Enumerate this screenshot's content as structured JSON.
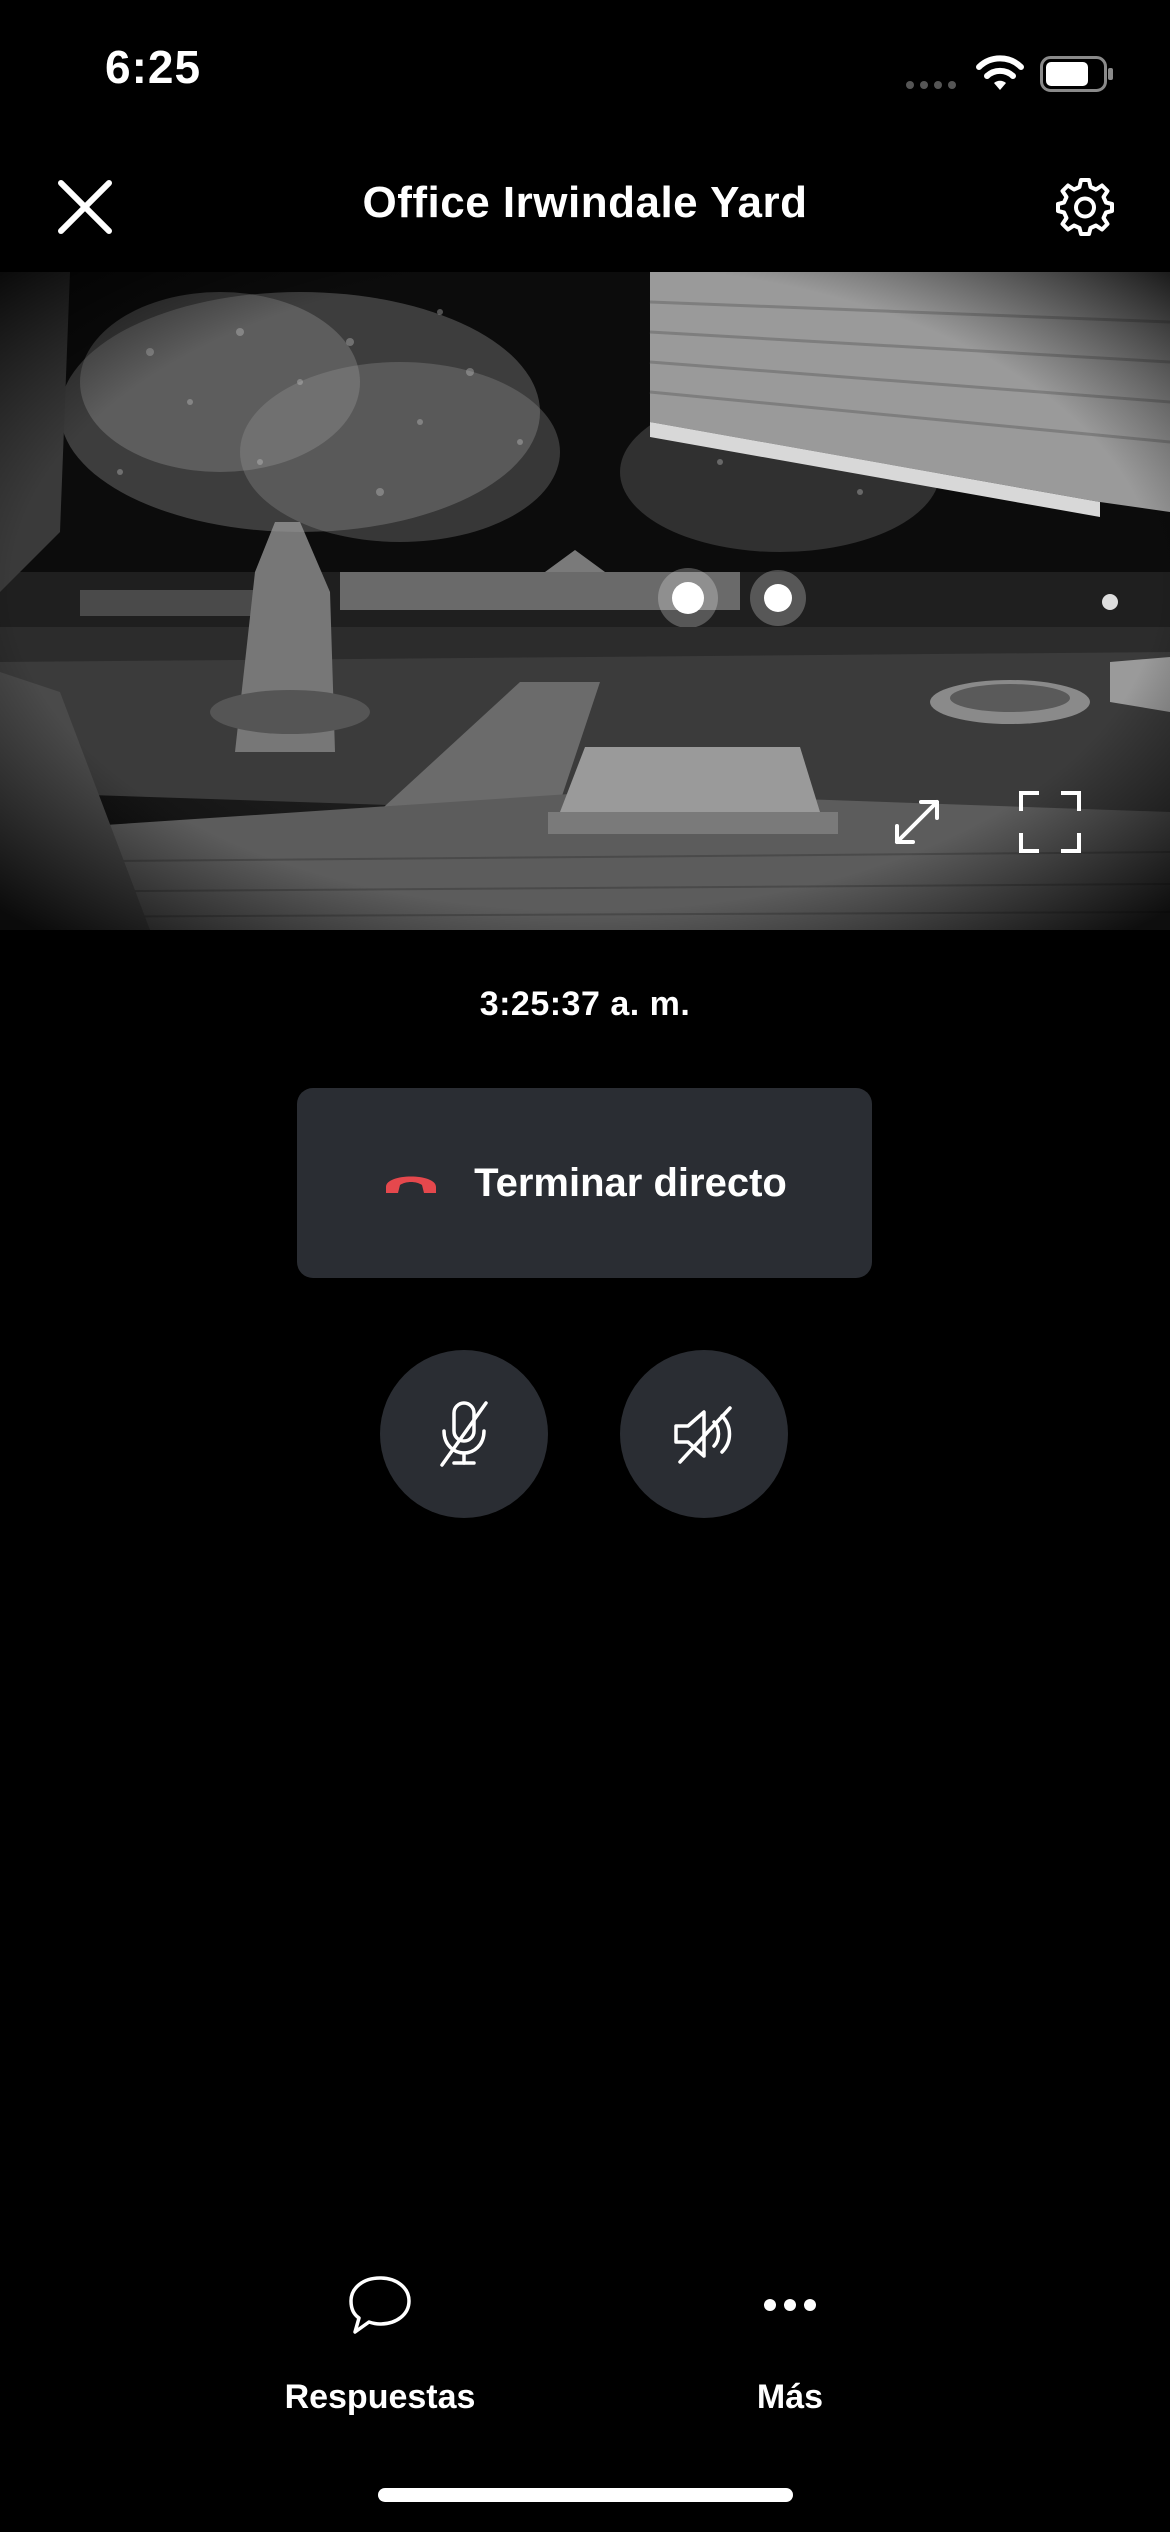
{
  "status_bar": {
    "time": "6:25"
  },
  "header": {
    "title": "Office Irwindale Yard",
    "close_icon": "close-icon",
    "settings_icon": "gear-icon"
  },
  "camera": {
    "expand_icon": "expand-arrows-icon",
    "fullscreen_icon": "fullscreen-icon"
  },
  "timestamp": "3:25:37 a. m.",
  "end_live": {
    "label": "Terminar directo",
    "icon": "hang-up-icon",
    "icon_color": "#e5484d"
  },
  "controls": {
    "mic_icon": "microphone-muted-icon",
    "speaker_icon": "speaker-muted-icon"
  },
  "bottom_nav": {
    "items": [
      {
        "label": "Respuestas",
        "icon": "chat-bubble-icon"
      },
      {
        "label": "Más",
        "icon": "more-dots-icon"
      }
    ]
  },
  "colors": {
    "background": "#000000",
    "button_bg": "#2a2d33",
    "accent_red": "#e5484d"
  }
}
